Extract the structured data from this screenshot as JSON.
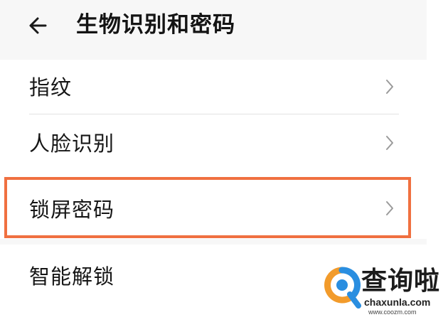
{
  "header": {
    "back_icon": "arrow-left-icon",
    "title": "生物识别和密码"
  },
  "settings": {
    "items": [
      {
        "label": "指纹",
        "icon": "chevron-right-icon"
      },
      {
        "label": "人脸识别",
        "icon": "chevron-right-icon"
      },
      {
        "label": "锁屏密码",
        "icon": "chevron-right-icon",
        "highlighted": true
      },
      {
        "label": "智能解锁",
        "icon": "chevron-right-icon"
      }
    ]
  },
  "annotation": {
    "highlight_color": "#f07040"
  },
  "watermark": {
    "cn": "查询啦",
    "en": "chaxunla.com",
    "url": "www.coozm.com",
    "logo_colors": [
      "#f29b2b",
      "#2a8ee0"
    ]
  }
}
